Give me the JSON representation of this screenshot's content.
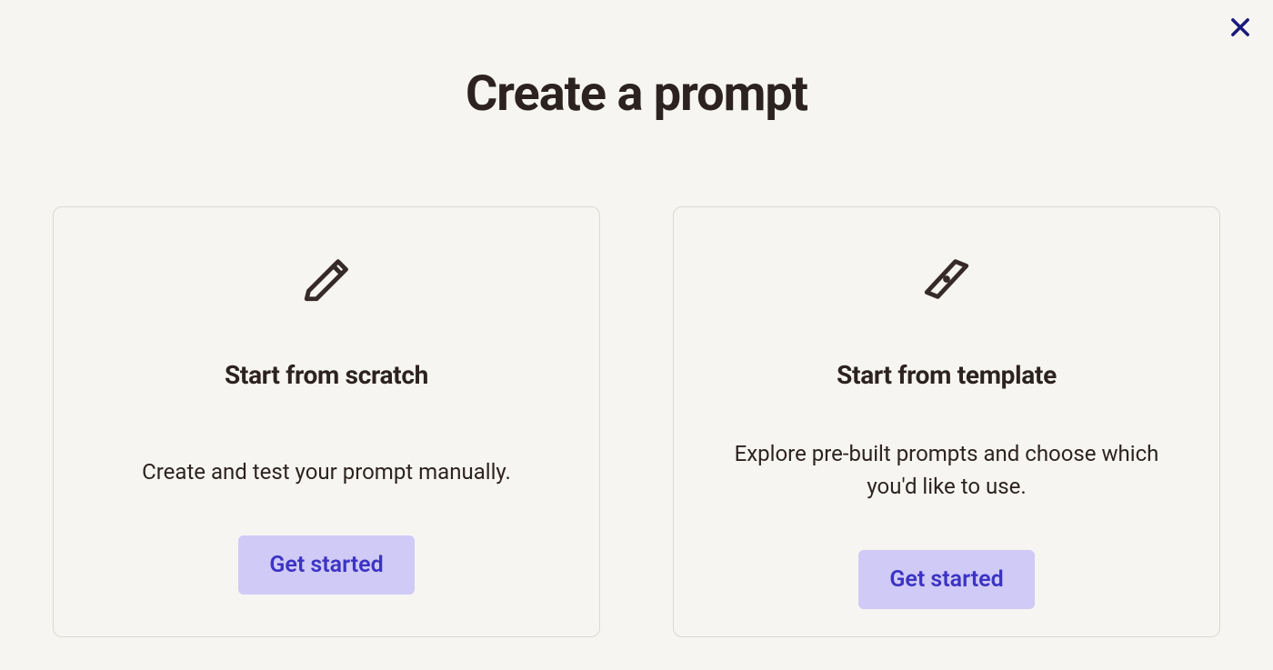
{
  "header": {
    "title": "Create a prompt"
  },
  "cards": [
    {
      "icon": "pencil-icon",
      "title": "Start from scratch",
      "description": "Create and test your prompt manually.",
      "button_label": "Get started"
    },
    {
      "icon": "compass-icon",
      "title": "Start from template",
      "description": "Explore pre-built prompts and choose which you'd like to use.",
      "button_label": "Get started"
    }
  ],
  "close_label": "Close"
}
